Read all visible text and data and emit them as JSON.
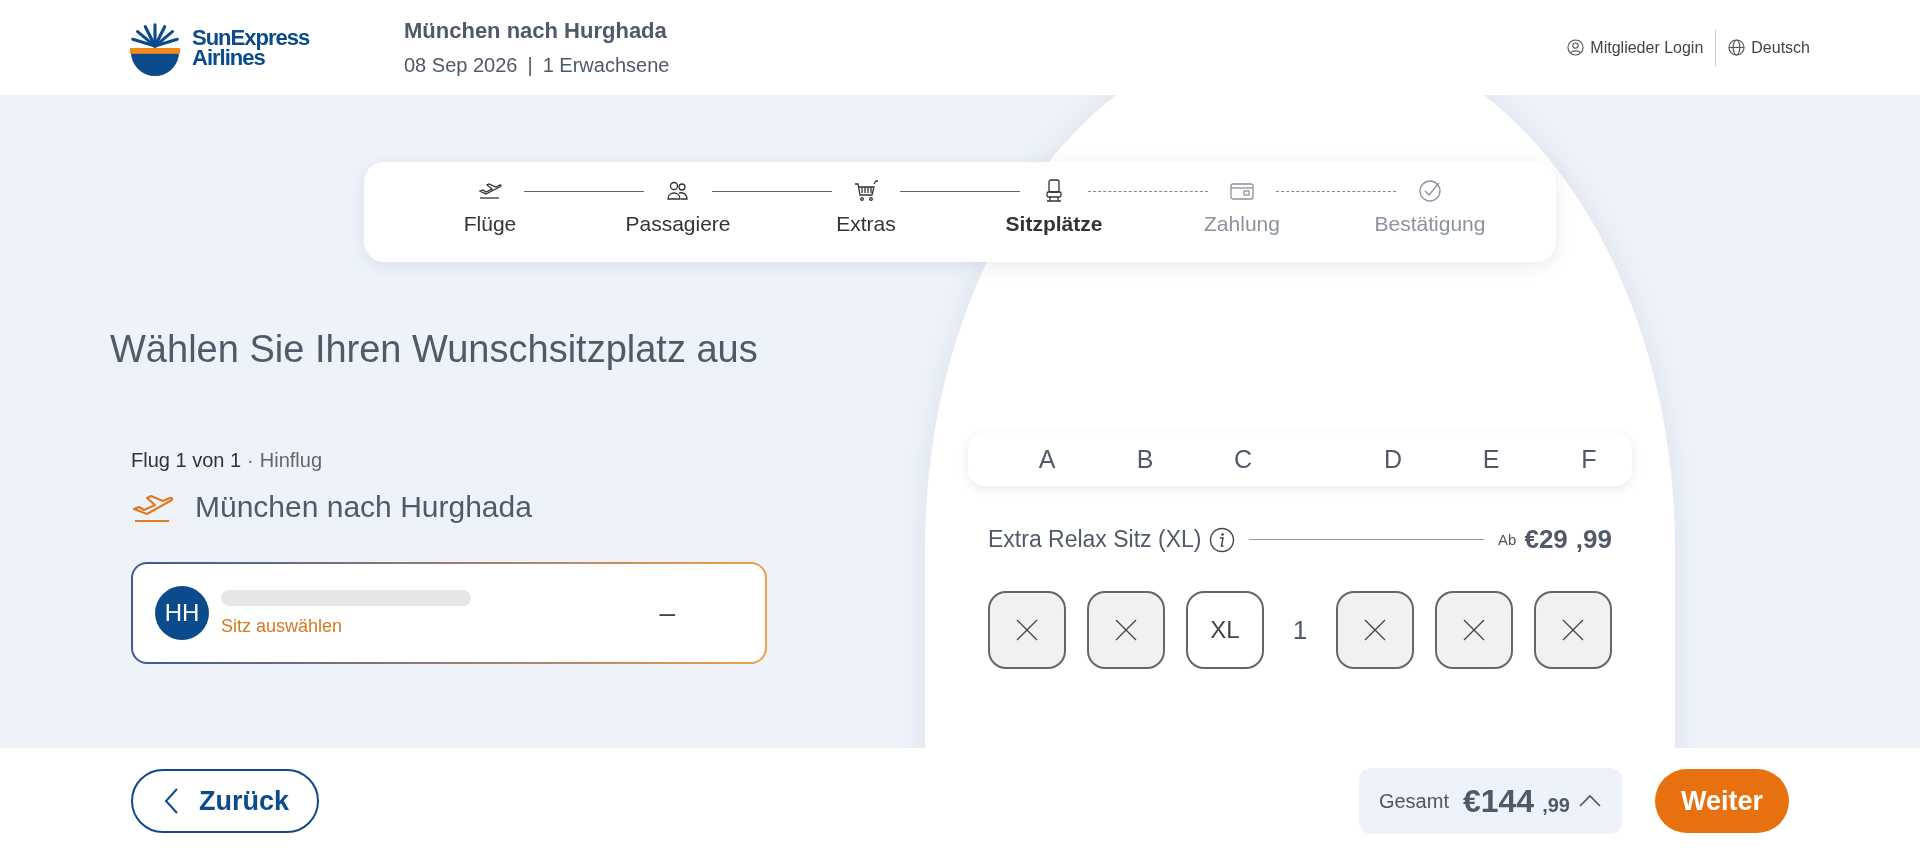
{
  "header": {
    "logo": {
      "line1": "SunExpress",
      "line2": "Airlines"
    },
    "route": "München nach Hurghada",
    "date": "08 Sep 2026",
    "separator": "|",
    "passengers": "1 Erwachsene",
    "links": [
      {
        "label": "Mitglieder Login",
        "kind": "user"
      },
      {
        "label": "Deutsch",
        "kind": "globe"
      }
    ]
  },
  "steps": [
    {
      "label": "Flüge",
      "kind": "plane",
      "selected": false,
      "disabled": false
    },
    {
      "label": "Passagiere",
      "kind": "people",
      "selected": false,
      "disabled": false
    },
    {
      "label": "Extras",
      "kind": "cart",
      "selected": false,
      "disabled": false
    },
    {
      "label": "Sitzplätze",
      "kind": "seat",
      "selected": true,
      "disabled": false
    },
    {
      "label": "Zahlung",
      "kind": "card",
      "selected": false,
      "disabled": true
    },
    {
      "label": "Bestätigung",
      "kind": "check",
      "selected": false,
      "disabled": true
    }
  ],
  "heading": "Wählen Sie Ihren Wunschsitzplatz aus",
  "flight": {
    "counter": "Flug 1 von 1",
    "separator": "·",
    "direction": "Hinflug",
    "route": "München nach Hurghada"
  },
  "passenger": {
    "initials": "HH",
    "action": "Sitz auswählen",
    "seat": "–"
  },
  "seatmap": {
    "columns": [
      "A",
      "B",
      "C",
      "D",
      "E",
      "F"
    ],
    "sections": [
      {
        "name": "Extra Relax Sitz (XL)",
        "prefix": "Ab",
        "price": "€29",
        "cents": ",99",
        "rows": [
          {
            "number": "1",
            "seats": [
              {
                "kind": "occupied"
              },
              {
                "kind": "occupied"
              },
              {
                "kind": "available",
                "label": "XL"
              },
              {
                "kind": "occupied"
              },
              {
                "kind": "occupied"
              },
              {
                "kind": "occupied"
              }
            ]
          }
        ]
      }
    ]
  },
  "footer": {
    "back": "Zurück",
    "total_label": "Gesamt",
    "total": "€144",
    "total_cents": ",99",
    "next": "Weiter"
  }
}
